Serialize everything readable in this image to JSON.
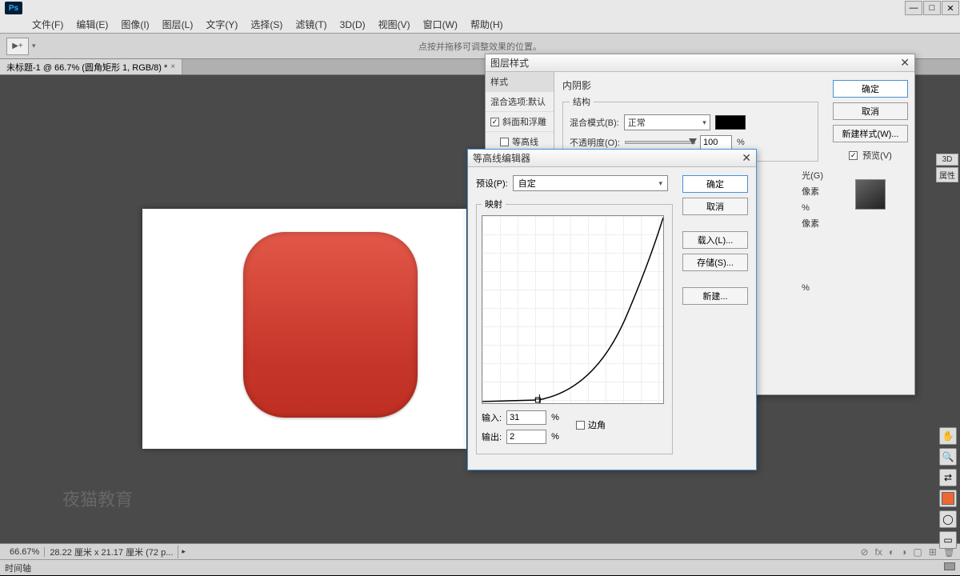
{
  "titlebar": {
    "logo": "Ps"
  },
  "menubar": {
    "file": "文件(F)",
    "edit": "编辑(E)",
    "image": "图像(I)",
    "layer": "图层(L)",
    "text": "文字(Y)",
    "select": "选择(S)",
    "filter": "滤镜(T)",
    "threeD": "3D(D)",
    "view": "视图(V)",
    "window": "窗口(W)",
    "help": "帮助(H)"
  },
  "optionsbar": {
    "tool": "▶+",
    "hint": "点按并拖移可调整效果的位置。"
  },
  "doctab": {
    "title": "未标题-1 @ 66.7% (圆角矩形 1, RGB/8) *",
    "close": "×"
  },
  "right_tabs": {
    "threeD": "3D",
    "props": "属性"
  },
  "watermark": "夜猫教育",
  "layerstyle": {
    "title": "图层样式",
    "left": {
      "styles": "样式",
      "blend_default": "混合选项:默认",
      "bevel": "斜面和浮雕",
      "contour_item": "等高线"
    },
    "section_title": "内阴影",
    "structure": "结构",
    "blend_mode_label": "混合模式(B):",
    "blend_mode_value": "正常",
    "opacity_label": "不透明度(O):",
    "opacity_value": "100",
    "percent": "%",
    "partial1": "光(G)",
    "partial2": "像素",
    "partial3": "%",
    "partial4": "像素",
    "partial5": "%",
    "buttons": {
      "ok": "确定",
      "cancel": "取消",
      "new_style": "新建样式(W)...",
      "preview": "预览(V)"
    }
  },
  "contour": {
    "title": "等高线编辑器",
    "preset_label": "预设(P):",
    "preset_value": "自定",
    "mapping": "映射",
    "input_label": "输入:",
    "input_value": "31",
    "output_label": "输出:",
    "output_value": "2",
    "percent": "%",
    "corner": "边角",
    "buttons": {
      "ok": "确定",
      "cancel": "取消",
      "load": "载入(L)...",
      "save": "存储(S)...",
      "new": "新建..."
    }
  },
  "statusbar": {
    "zoom": "66.67%",
    "docinfo": "28.22 厘米 x 21.17 厘米 (72 p..."
  },
  "timeline": {
    "label": "时间轴"
  }
}
